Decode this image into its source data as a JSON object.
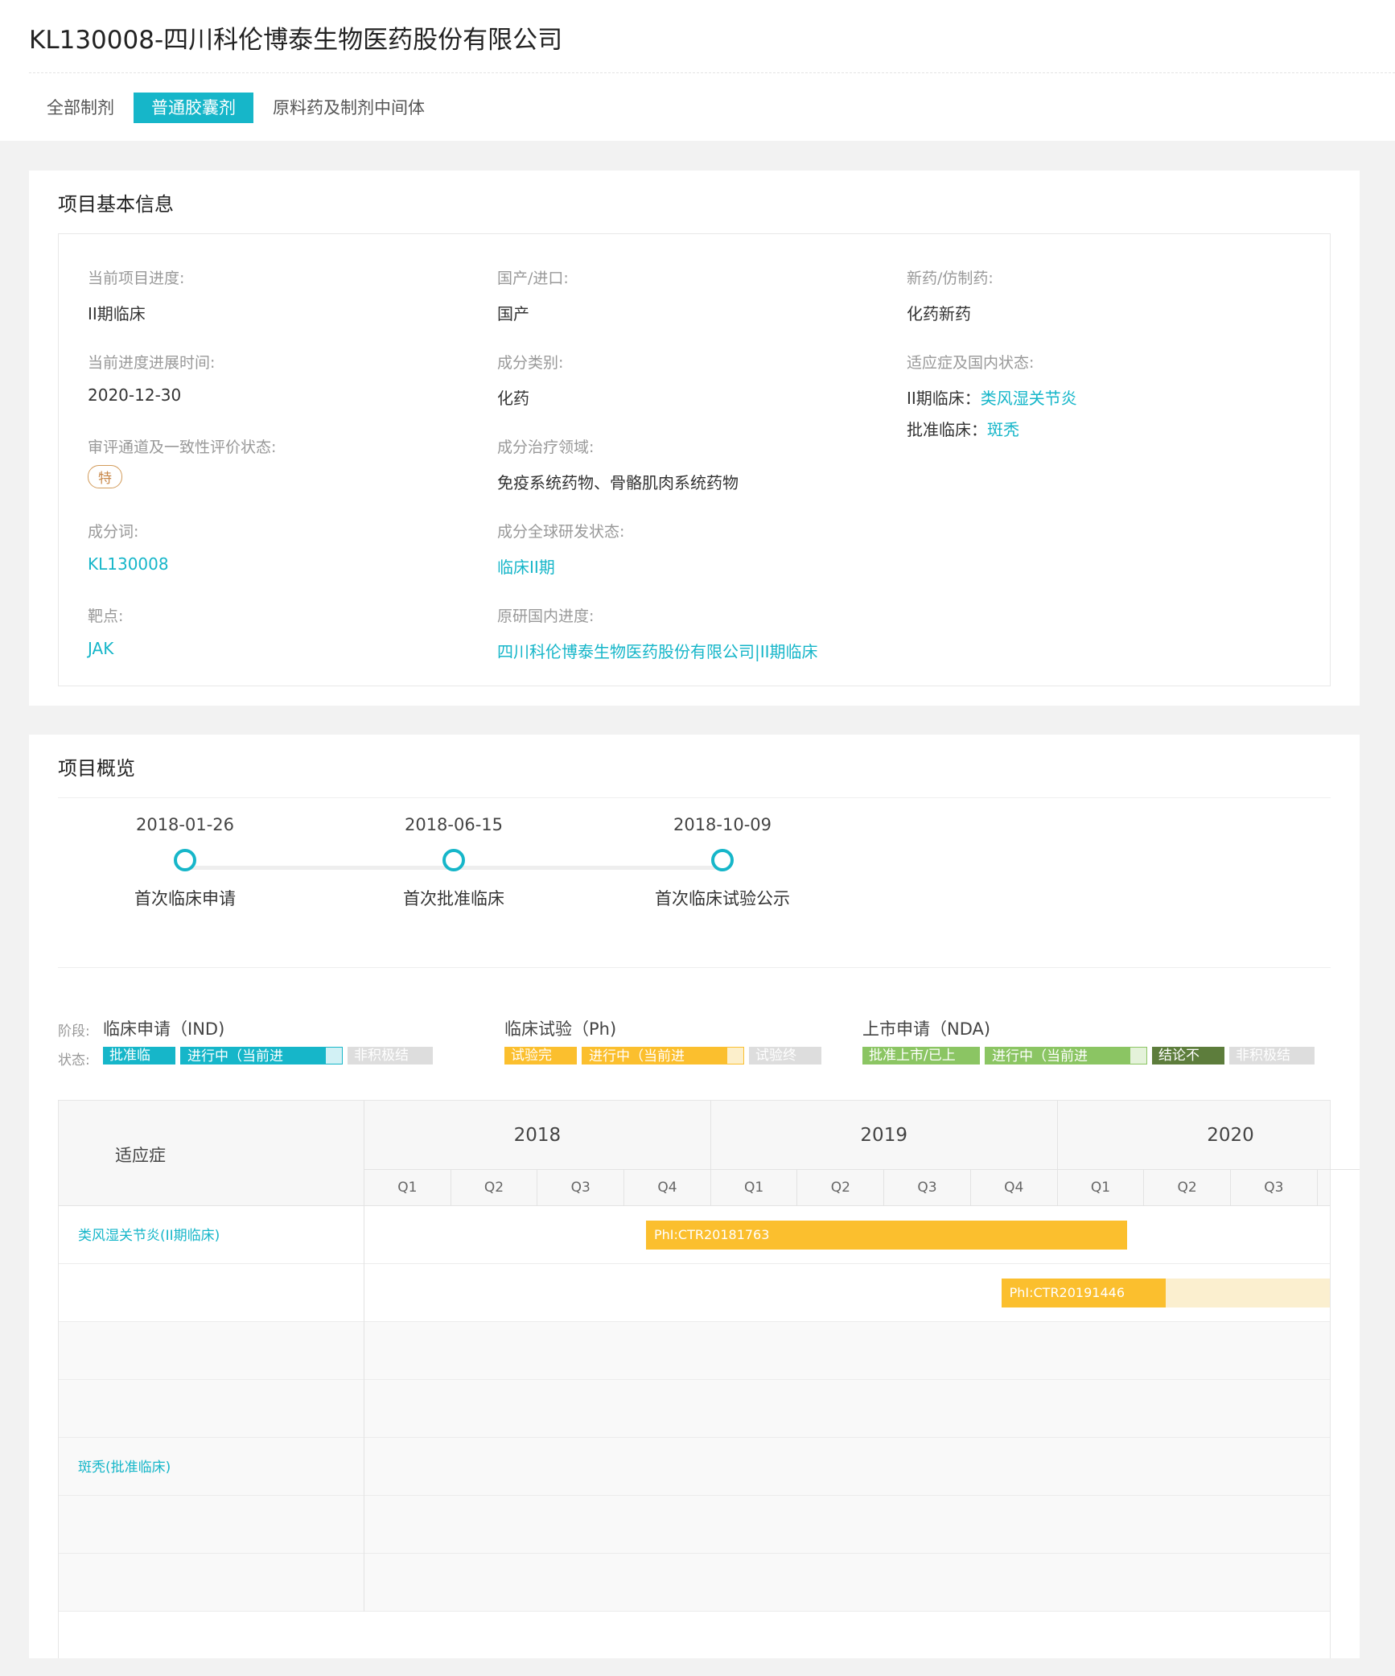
{
  "page": {
    "title": "KL130008-四川科伦博泰生物医药股份有限公司",
    "tabs": [
      {
        "label": "全部制剂",
        "active": false
      },
      {
        "label": "普通胶囊剂",
        "active": true
      },
      {
        "label": "原料药及制剂中间体",
        "active": false
      }
    ]
  },
  "basic_info": {
    "section_title": "项目基本信息",
    "current_progress": {
      "label": "当前项目进度:",
      "value": "II期临床"
    },
    "origin": {
      "label": "国产/进口:",
      "value": "国产"
    },
    "drug_type": {
      "label": "新药/仿制药:",
      "value": "化药新药"
    },
    "progress_time": {
      "label": "当前进度进展时间:",
      "value": "2020-12-30"
    },
    "component_category": {
      "label": "成分类别:",
      "value": "化药"
    },
    "indication_status": {
      "label": "适应症及国内状态:",
      "items": [
        {
          "stage": "II期临床：",
          "name": "类风湿关节炎"
        },
        {
          "stage": "批准临床：",
          "name": "斑秃"
        }
      ]
    },
    "review_channel": {
      "label": "审评通道及一致性评价状态:",
      "badge": "特"
    },
    "therapeutic_area": {
      "label": "成分治疗领域:",
      "value": "免疫系统药物、骨骼肌肉系统药物"
    },
    "component_word": {
      "label": "成分词:",
      "value": "KL130008"
    },
    "global_status": {
      "label": "成分全球研发状态:",
      "value": "临床II期"
    },
    "target": {
      "label": "靶点:",
      "value": "JAK"
    },
    "original_progress": {
      "label": "原研国内进度:",
      "value": "四川科伦博泰生物医药股份有限公司|II期临床"
    }
  },
  "overview": {
    "section_title": "项目概览",
    "milestones": [
      {
        "date": "2018-01-26",
        "label": "首次临床申请"
      },
      {
        "date": "2018-06-15",
        "label": "首次批准临床"
      },
      {
        "date": "2018-10-09",
        "label": "首次临床试验公示"
      }
    ],
    "legend": {
      "stage_key": "阶段:",
      "status_key": "状态:",
      "groups": [
        {
          "title": "临床申请（IND)",
          "items": [
            {
              "text": "批准临",
              "color": "#16b6c9"
            },
            {
              "text": "进行中（当前进",
              "color": "#16b6c9",
              "tail": "#d2f1f5"
            },
            {
              "text": "非积极结",
              "color": "#dddddd"
            }
          ]
        },
        {
          "title": "临床试验（Ph)",
          "items": [
            {
              "text": "试验完",
              "color": "#fbbf2e"
            },
            {
              "text": "进行中（当前进",
              "color": "#fbbf2e",
              "tail": "#fcefcb"
            },
            {
              "text": "试验终",
              "color": "#dddddd"
            }
          ]
        },
        {
          "title": "上市申请（NDA)",
          "items": [
            {
              "text": "批准上市/已上",
              "color": "#8bc563"
            },
            {
              "text": "进行中（当前进",
              "color": "#8bc563",
              "tail": "#e4f2da"
            },
            {
              "text": "结论不",
              "color": "#5d7d3c"
            },
            {
              "text": "非积极结",
              "color": "#dddddd"
            }
          ]
        }
      ]
    },
    "gantt": {
      "indication_header": "适应症",
      "years": [
        "2018",
        "2019",
        "2020"
      ],
      "quarters": [
        "Q1",
        "Q2",
        "Q3",
        "Q4",
        "Q1",
        "Q2",
        "Q3",
        "Q4",
        "Q1",
        "Q2",
        "Q3"
      ],
      "rows": [
        {
          "indication": "类风湿关节炎(II期临床)",
          "bar": {
            "label": "PhI:CTR20181763",
            "start_q": 3.25,
            "end_q": 8.8,
            "color": "#fbbf2e"
          }
        },
        {
          "indication": "",
          "bar": {
            "label": "PhI:CTR20191446",
            "start_q": 7.35,
            "end_q": 9.25,
            "color": "#fbbf2e",
            "ongoing": true
          }
        },
        {
          "indication": "",
          "bar": null
        },
        {
          "indication": "",
          "bar": null
        },
        {
          "indication": "斑秃(批准临床)",
          "bar": null
        },
        {
          "indication": "",
          "bar": null
        },
        {
          "indication": "",
          "bar": null
        }
      ]
    }
  }
}
